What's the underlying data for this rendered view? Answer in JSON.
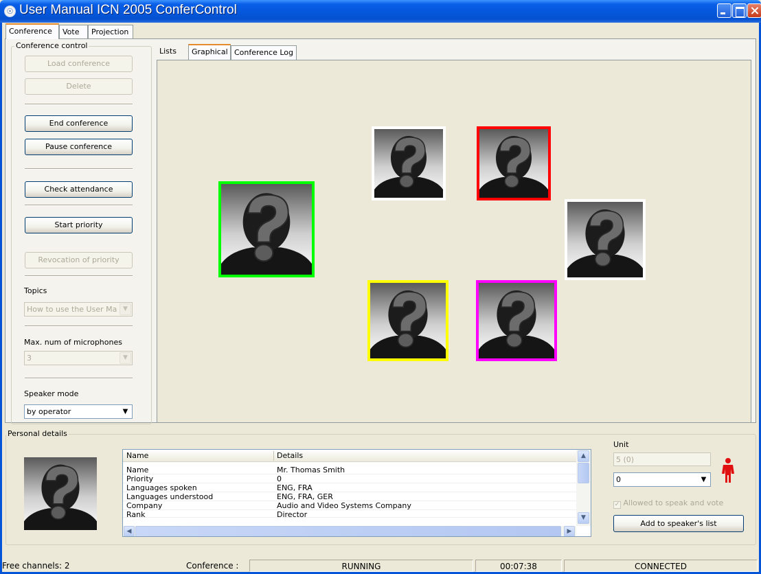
{
  "window": {
    "title": "User Manual ICN 2005 ConferControl"
  },
  "main_tabs": [
    {
      "label": "Conference"
    },
    {
      "label": "Vote"
    },
    {
      "label": "Projection"
    }
  ],
  "conference_control": {
    "group_label": "Conference control",
    "load_conference": "Load conference",
    "delete": "Delete",
    "end_conference": "End conference",
    "pause_conference": "Pause conference",
    "check_attendance": "Check attendance",
    "start_priority": "Start priority",
    "revocation_of_priority": "Revocation of priority",
    "topics_label": "Topics",
    "topics_value": "How to use the User Man",
    "max_mics_label": "Max. num of microphones",
    "max_mics_value": "3",
    "speaker_mode_label": "Speaker mode",
    "speaker_mode_value": "by operator"
  },
  "view_tabs": [
    {
      "label": "Lists"
    },
    {
      "label": "Graphical"
    },
    {
      "label": "Conference Log"
    }
  ],
  "seats": [
    {
      "name": "seat-green",
      "border_color": "#00ff00"
    },
    {
      "name": "seat-white-1",
      "border_color": "#ffffff"
    },
    {
      "name": "seat-red",
      "border_color": "#ff0000"
    },
    {
      "name": "seat-white-2",
      "border_color": "#ffffff"
    },
    {
      "name": "seat-yellow",
      "border_color": "#ffff00"
    },
    {
      "name": "seat-magenta",
      "border_color": "#ff00ff"
    }
  ],
  "personal_details": {
    "group_label": "Personal details",
    "col_name": "Name",
    "col_details": "Details",
    "rows": [
      {
        "name": "Name",
        "details": "Mr. Thomas Smith"
      },
      {
        "name": "Priority",
        "details": "0"
      },
      {
        "name": "Languages spoken",
        "details": "ENG, FRA"
      },
      {
        "name": "Languages understood",
        "details": "ENG, FRA, GER"
      },
      {
        "name": "Company",
        "details": "Audio and Video Systems Company"
      },
      {
        "name": "Rank",
        "details": "Director"
      }
    ],
    "unit_label": "Unit",
    "unit_value": "5 (0)",
    "unit_select_value": "0",
    "allowed_label": "Allowed to speak and vote",
    "add_speaker_button": "Add to speaker's list"
  },
  "status_bar": {
    "free_channels": "Free channels: 2",
    "conference_label": "Conference :",
    "state": "RUNNING",
    "time": "00:07:38",
    "connection": "CONNECTED"
  },
  "colors": {
    "title_bar": "#0558dc",
    "active_tab_accent": "#e68b2c",
    "speaker_icon": "#e01010"
  }
}
